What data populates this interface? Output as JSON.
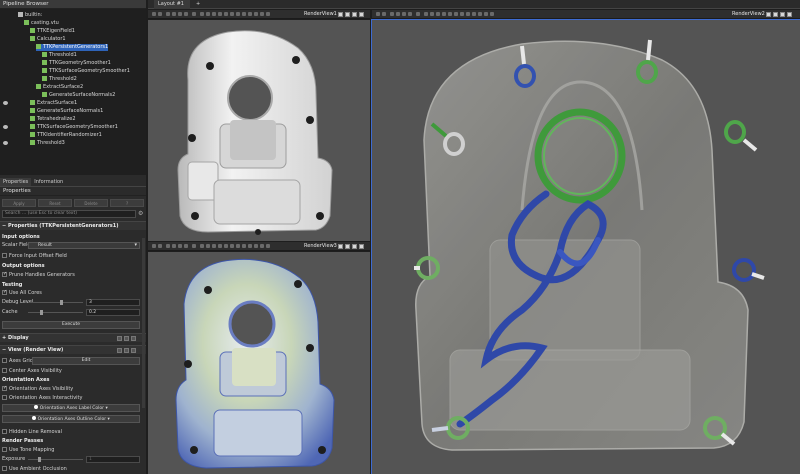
{
  "pipeline": {
    "title": "Pipeline Browser",
    "items": [
      {
        "label": "builtin:",
        "depth": 0,
        "visible": false
      },
      {
        "label": "casting.vtu",
        "depth": 1,
        "visible": false
      },
      {
        "label": "TTKEigenField1",
        "depth": 2,
        "visible": false
      },
      {
        "label": "Calculator1",
        "depth": 2,
        "visible": false
      },
      {
        "label": "TTKPersistentGenerators1",
        "depth": 3,
        "visible": false,
        "selected": true
      },
      {
        "label": "Threshold1",
        "depth": 4,
        "visible": false
      },
      {
        "label": "TTKGeometrySmoother1",
        "depth": 4,
        "visible": false
      },
      {
        "label": "TTKSurfaceGeometrySmoother1",
        "depth": 4,
        "visible": false
      },
      {
        "label": "Threshold2",
        "depth": 4,
        "visible": false
      },
      {
        "label": "ExtractSurface2",
        "depth": 3,
        "visible": false
      },
      {
        "label": "GenerateSurfaceNormals2",
        "depth": 4,
        "visible": false
      },
      {
        "label": "ExtractSurface1",
        "depth": 2,
        "visible": true
      },
      {
        "label": "GenerateSurfaceNormals1",
        "depth": 2,
        "visible": false
      },
      {
        "label": "Tetrahedralize2",
        "depth": 2,
        "visible": false
      },
      {
        "label": "TTKSurfaceGeometrySmoother1",
        "depth": 2,
        "visible": true
      },
      {
        "label": "TTKIdentifierRandomizer1",
        "depth": 2,
        "visible": false
      },
      {
        "label": "Threshold3",
        "depth": 2,
        "visible": true
      }
    ]
  },
  "panel_tabs": [
    "Properties",
    "Information"
  ],
  "properties": {
    "header": "Properties",
    "buttons": [
      "Apply",
      "Reset",
      "Delete",
      "?"
    ],
    "search_placeholder": "Search ... (use Esc to clear text)",
    "filter_title": "Properties (TTKPersistentGenerators1)",
    "input_options": "Input options",
    "scalar_field_label": "Scalar Field",
    "scalar_field_value": "Result",
    "force_input_offset": "Force Input Offset Field",
    "output_options": "Output options",
    "prune_handles": "Prune Handles Generators",
    "testing": "Testing",
    "use_all_cores": "Use All Cores",
    "debug_level_label": "Debug Level",
    "debug_level_value": "3",
    "cache_label": "Cache",
    "cache_value": "0.2",
    "execute": "Execute",
    "display": "Display",
    "view_section": "View (Render View)",
    "axes_grid": "Axes Grid",
    "edit": "Edit",
    "center_axes_visibility": "Center Axes Visibility",
    "orientation_axes": "Orientation Axes",
    "orientation_axes_visibility": "Orientation Axes Visibility",
    "orientation_axes_interactivity": "Orientation Axes Interactivity",
    "orientation_label_color": "Orientation Axes Label Color",
    "orientation_outline_color": "Orientation Axes Outline Color",
    "hidden_line_removal": "Hidden Line Removal",
    "render_passes": "Render Passes",
    "use_tone_mapping": "Use Tone Mapping",
    "exposure": "Exposure",
    "exposure_value": "1",
    "use_ambient_occlusion": "Use Ambient Occlusion"
  },
  "layout": {
    "tab_label": "Layout #1",
    "add_tab": "+",
    "views": {
      "v1": "RenderView1",
      "v2": "RenderView2",
      "v3": "RenderView3"
    }
  },
  "colors": {
    "accent": "#3d6bd1",
    "generator_blue": "#2f48a8",
    "generator_green": "#4fa64a",
    "casting_gray": "#8a8a86",
    "background": "#545454"
  }
}
